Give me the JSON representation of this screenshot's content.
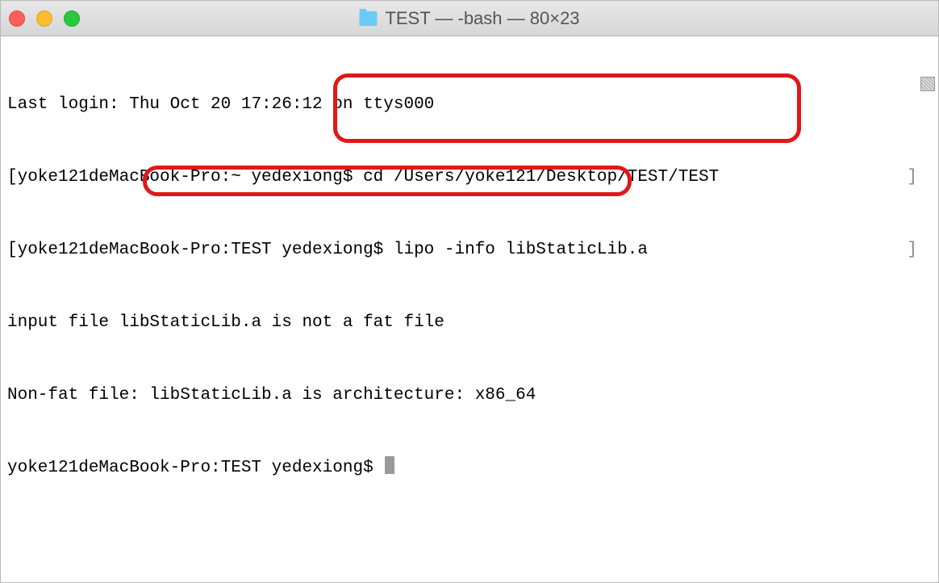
{
  "window": {
    "title": "TEST — -bash — 80×23"
  },
  "terminal": {
    "lines": [
      {
        "left": "Last login: Thu Oct 20 17:26:12 on ttys000",
        "right": ""
      },
      {
        "left": "[yoke121deMacBook-Pro:~ yedexiong$ cd /Users/yoke121/Desktop/TEST/TEST",
        "right": "]"
      },
      {
        "left": "[yoke121deMacBook-Pro:TEST yedexiong$ lipo -info libStaticLib.a",
        "right": "]"
      },
      {
        "left": "input file libStaticLib.a is not a fat file",
        "right": ""
      },
      {
        "left": "Non-fat file: libStaticLib.a is architecture: x86_64",
        "right": ""
      },
      {
        "left": "yoke121deMacBook-Pro:TEST yedexiong$ ",
        "right": ""
      }
    ]
  }
}
